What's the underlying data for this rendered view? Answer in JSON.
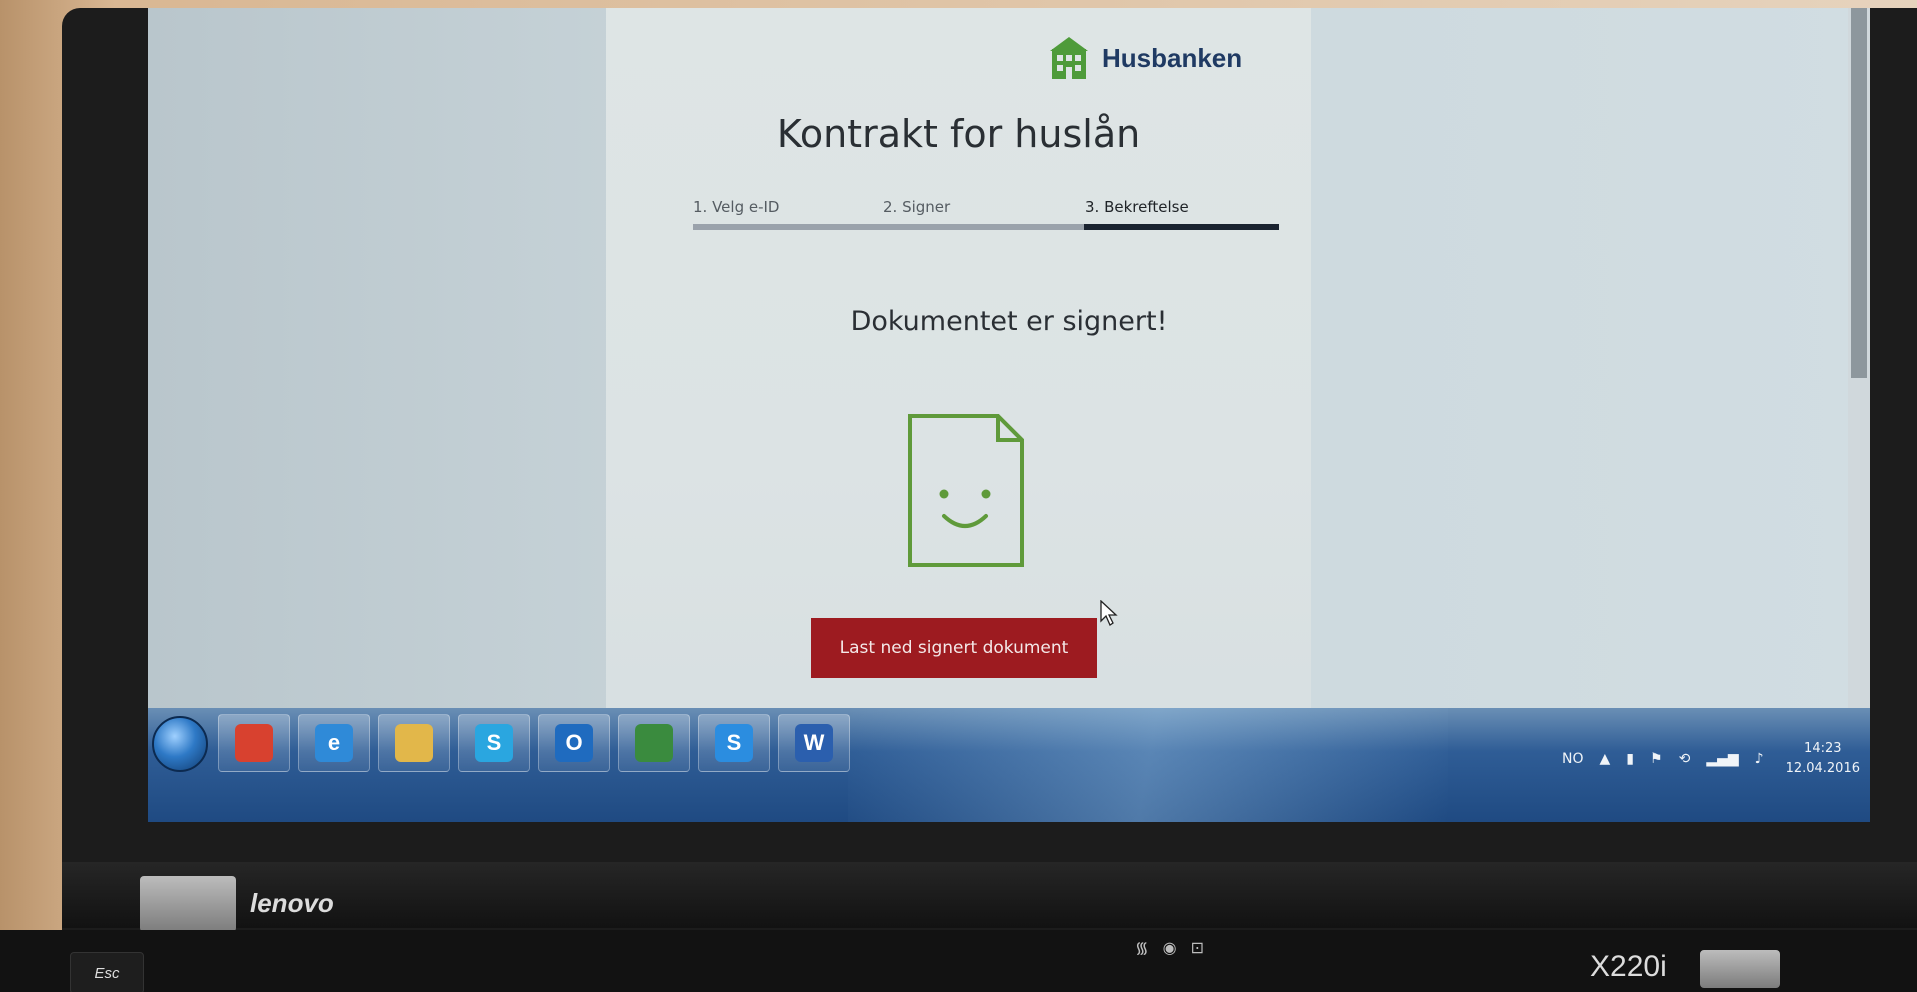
{
  "brand": {
    "name": "Husbanken",
    "color": "#1f3a63",
    "mark_color": "#4e9b3a"
  },
  "page": {
    "title": "Kontrakt for huslån",
    "status_message": "Dokumentet er signert!",
    "download_button_label": "Last ned signert dokument",
    "button_color": "#9d1b20",
    "document_icon_color": "#5f9a3a"
  },
  "steps": {
    "items": [
      {
        "label": "1. Velg e-ID",
        "active": false
      },
      {
        "label": "2. Signer",
        "active": false
      },
      {
        "label": "3. Bekreftelse",
        "active": true
      }
    ],
    "current_step": 3,
    "total_steps": 3
  },
  "taskbar": {
    "apps": [
      {
        "name": "chrome-icon",
        "glyph": "",
        "color": "#d8412f"
      },
      {
        "name": "internet-explorer-icon",
        "glyph": "e",
        "color": "#2f8ad8"
      },
      {
        "name": "file-explorer-icon",
        "glyph": "",
        "color": "#e2b74a"
      },
      {
        "name": "skype-icon",
        "glyph": "S",
        "color": "#2aa6e0"
      },
      {
        "name": "outlook-icon",
        "glyph": "O",
        "color": "#1f6bbf"
      },
      {
        "name": "project-icon",
        "glyph": "",
        "color": "#3a8b3e"
      },
      {
        "name": "skype-for-business-icon",
        "glyph": "S",
        "color": "#2b8de0"
      },
      {
        "name": "word-icon",
        "glyph": "W",
        "color": "#2b5fae"
      }
    ],
    "tray": {
      "language": "NO",
      "time": "14:23",
      "date": "12.04.2016"
    }
  },
  "laptop": {
    "brand_label": "lenovo",
    "model_label": "X220i",
    "esc_label": "Esc"
  }
}
